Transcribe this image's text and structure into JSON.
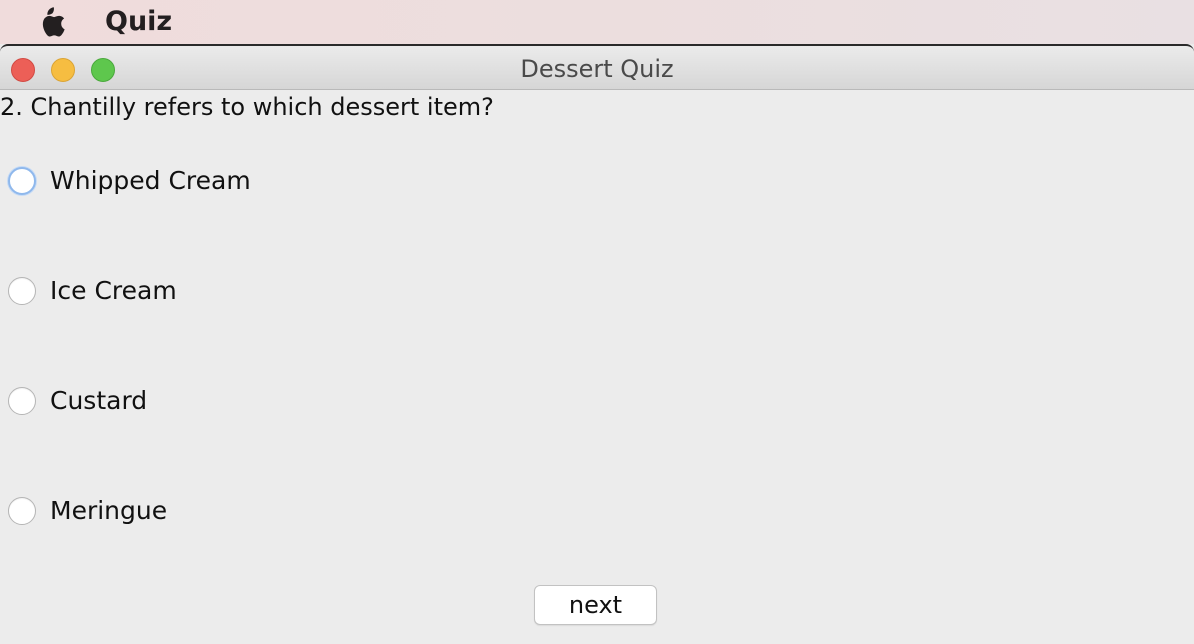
{
  "menubar": {
    "app_name": "Quiz",
    "apple_icon": "apple-logo-icon"
  },
  "window": {
    "title": "Dessert Quiz",
    "buttons": [
      "close",
      "minimize",
      "zoom"
    ]
  },
  "quiz": {
    "question": "2. Chantilly refers to which dessert item?",
    "options": [
      {
        "label": "Whipped Cream",
        "selected": false,
        "focused": true
      },
      {
        "label": "Ice Cream",
        "selected": false,
        "focused": false
      },
      {
        "label": "Custard",
        "selected": false,
        "focused": false
      },
      {
        "label": "Meringue",
        "selected": false,
        "focused": false
      }
    ],
    "next_label": "next"
  }
}
